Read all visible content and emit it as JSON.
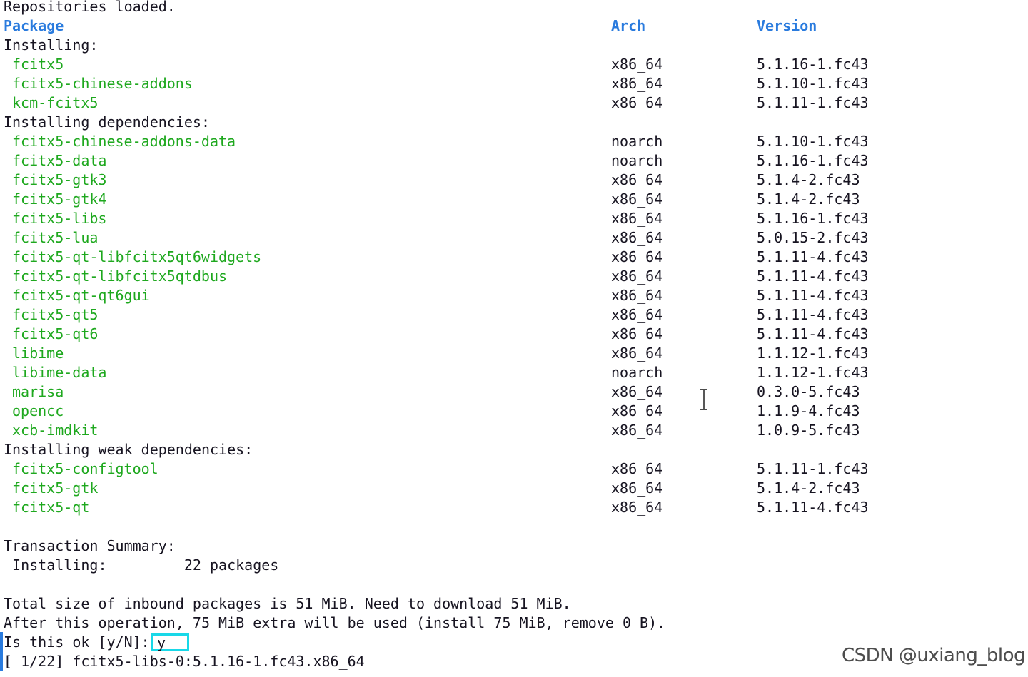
{
  "header_line": "Repositories loaded.",
  "columns": {
    "package": "Package",
    "arch": "Arch",
    "version": "Version"
  },
  "section_installing": "Installing:",
  "section_dependencies": "Installing dependencies:",
  "section_weak": "Installing weak dependencies:",
  "installing": [
    {
      "name": "fcitx5",
      "arch": "x86_64",
      "version": "5.1.16-1.fc43"
    },
    {
      "name": "fcitx5-chinese-addons",
      "arch": "x86_64",
      "version": "5.1.10-1.fc43"
    },
    {
      "name": "kcm-fcitx5",
      "arch": "x86_64",
      "version": "5.1.11-1.fc43"
    }
  ],
  "dependencies": [
    {
      "name": "fcitx5-chinese-addons-data",
      "arch": "noarch",
      "version": "5.1.10-1.fc43"
    },
    {
      "name": "fcitx5-data",
      "arch": "noarch",
      "version": "5.1.16-1.fc43"
    },
    {
      "name": "fcitx5-gtk3",
      "arch": "x86_64",
      "version": "5.1.4-2.fc43"
    },
    {
      "name": "fcitx5-gtk4",
      "arch": "x86_64",
      "version": "5.1.4-2.fc43"
    },
    {
      "name": "fcitx5-libs",
      "arch": "x86_64",
      "version": "5.1.16-1.fc43"
    },
    {
      "name": "fcitx5-lua",
      "arch": "x86_64",
      "version": "5.0.15-2.fc43"
    },
    {
      "name": "fcitx5-qt-libfcitx5qt6widgets",
      "arch": "x86_64",
      "version": "5.1.11-4.fc43"
    },
    {
      "name": "fcitx5-qt-libfcitx5qtdbus",
      "arch": "x86_64",
      "version": "5.1.11-4.fc43"
    },
    {
      "name": "fcitx5-qt-qt6gui",
      "arch": "x86_64",
      "version": "5.1.11-4.fc43"
    },
    {
      "name": "fcitx5-qt5",
      "arch": "x86_64",
      "version": "5.1.11-4.fc43"
    },
    {
      "name": "fcitx5-qt6",
      "arch": "x86_64",
      "version": "5.1.11-4.fc43"
    },
    {
      "name": "libime",
      "arch": "x86_64",
      "version": "1.1.12-1.fc43"
    },
    {
      "name": "libime-data",
      "arch": "noarch",
      "version": "1.1.12-1.fc43"
    },
    {
      "name": "marisa",
      "arch": "x86_64",
      "version": "0.3.0-5.fc43"
    },
    {
      "name": "opencc",
      "arch": "x86_64",
      "version": "1.1.9-4.fc43"
    },
    {
      "name": "xcb-imdkit",
      "arch": "x86_64",
      "version": "1.0.9-5.fc43"
    }
  ],
  "weak_dependencies": [
    {
      "name": "fcitx5-configtool",
      "arch": "x86_64",
      "version": "5.1.11-1.fc43"
    },
    {
      "name": "fcitx5-gtk",
      "arch": "x86_64",
      "version": "5.1.4-2.fc43"
    },
    {
      "name": "fcitx5-qt",
      "arch": "x86_64",
      "version": "5.1.11-4.fc43"
    }
  ],
  "summary_title": "Transaction Summary:",
  "summary_installing": " Installing:         22 packages",
  "total_size": "Total size of inbound packages is 51 MiB. Need to download 51 MiB.",
  "after_op": "After this operation, 75 MiB extra will be used (install 75 MiB, remove 0 B).",
  "prompt": "Is this ok [y/N]:",
  "prompt_value": "y",
  "progress_line": "[ 1/22] fcitx5-libs-0:5.1.16-1.fc43.x86_64",
  "watermark": "CSDN @uxiang_blog",
  "colors": {
    "header_blue": "#2a7bde",
    "package_green": "#1ea81e",
    "input_highlight": "#18d8e8"
  }
}
